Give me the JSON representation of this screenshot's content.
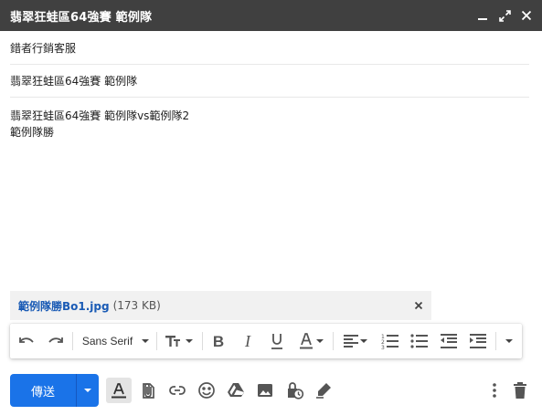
{
  "window": {
    "title": "翡翠狂蛙區64強賽 範例隊"
  },
  "compose": {
    "from": "錯者行銷客服",
    "subject": "翡翠狂蛙區64強賽 範例隊",
    "body_lines": [
      "翡翠狂蛙區64強賽 範例隊vs範例隊2",
      "範例隊勝"
    ]
  },
  "attachment": {
    "name": "範例隊勝Bo1.jpg",
    "size": "(173 KB)"
  },
  "toolbar": {
    "font": "Sans Serif"
  },
  "bottom": {
    "send_label": "傳送"
  },
  "colors": {
    "titlebar": "#404040",
    "send": "#1a73e8",
    "attachment_link": "#1a5bb5"
  }
}
